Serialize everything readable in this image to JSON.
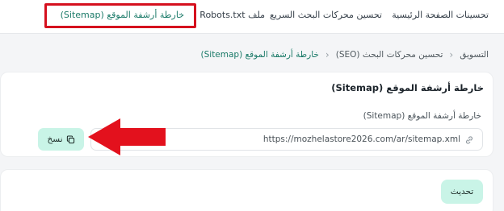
{
  "tabs": [
    {
      "label": "تحسينات الصفحة الرئيسية",
      "active": false
    },
    {
      "label": "تحسين محركات البحث السريع",
      "active": false
    },
    {
      "label": "ملف Robots.txt",
      "active": false
    },
    {
      "label": "خارطة أرشفة الموقع (Sitemap)",
      "active": true
    }
  ],
  "breadcrumb": [
    "التسويق",
    "تحسين محركات البحث (SEO)",
    "خارطة أرشفة الموقع (Sitemap)"
  ],
  "card": {
    "title": "خارطة أرشفة الموقع (Sitemap)",
    "field_label": "خارطة أرشفة الموقع (Sitemap)",
    "url_value": "https://mozhelastore2026.com/ar/sitemap.xml",
    "copy_label": "نسخ"
  },
  "refresh_label": "تحديث",
  "colors": {
    "accent": "#1a7a68",
    "button_bg": "#c9f4e7",
    "highlight": "#d5101e"
  },
  "icons": [
    "link-icon",
    "copy-icon",
    "chevron-left-icon"
  ]
}
